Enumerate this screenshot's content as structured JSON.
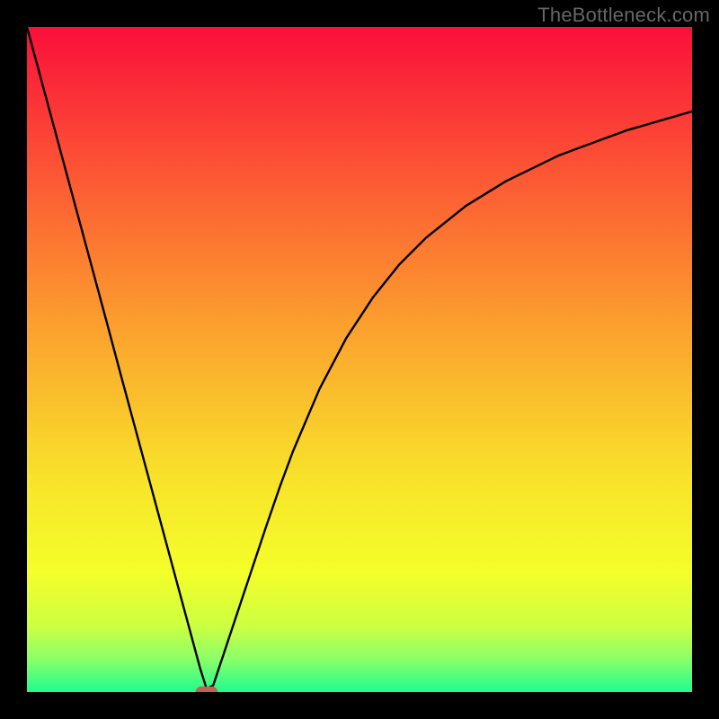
{
  "watermark": "TheBottleneck.com",
  "chart_data": {
    "type": "line",
    "title": "",
    "xlabel": "",
    "ylabel": "",
    "xlim": [
      0,
      100
    ],
    "ylim": [
      0,
      100
    ],
    "grid": false,
    "legend": false,
    "background_gradient": {
      "type": "rainbow_vertical",
      "stops": [
        {
          "pos": 0.0,
          "color": "#fa0f3a"
        },
        {
          "pos": 0.22,
          "color": "#fc5634"
        },
        {
          "pos": 0.45,
          "color": "#fba02e"
        },
        {
          "pos": 0.68,
          "color": "#f8e32a"
        },
        {
          "pos": 0.82,
          "color": "#f4fe29"
        },
        {
          "pos": 0.9,
          "color": "#cdff41"
        },
        {
          "pos": 0.95,
          "color": "#8cff69"
        },
        {
          "pos": 1.0,
          "color": "#1dfd8e"
        }
      ]
    },
    "series": [
      {
        "name": "bottleneck-curve",
        "color": "#000000",
        "x": [
          0,
          2,
          4,
          6,
          8,
          10,
          12,
          14,
          16,
          18,
          20,
          22,
          24,
          26,
          27,
          28,
          30,
          32,
          34,
          36,
          38,
          40,
          44,
          48,
          52,
          56,
          60,
          66,
          72,
          80,
          90,
          100
        ],
        "y": [
          100,
          92.6,
          85.2,
          77.8,
          70.4,
          63.0,
          55.6,
          48.1,
          40.7,
          33.3,
          25.9,
          18.5,
          11.1,
          3.7,
          0.5,
          1.0,
          7.0,
          13.0,
          19.0,
          25.0,
          30.8,
          36.2,
          45.6,
          53.2,
          59.3,
          64.3,
          68.3,
          73.1,
          76.8,
          80.7,
          84.4,
          87.3
        ]
      }
    ],
    "marker": {
      "shape": "rounded-rect",
      "x": 27,
      "y": 0,
      "width_frac": 0.033,
      "height_frac": 0.017,
      "color": "#c06058"
    }
  }
}
